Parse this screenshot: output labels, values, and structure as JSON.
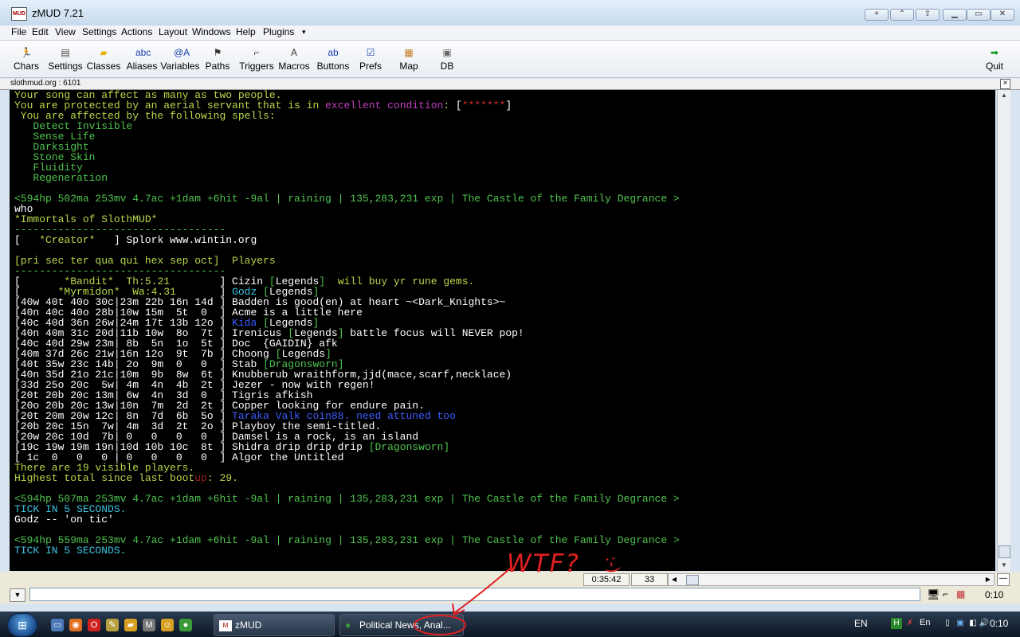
{
  "window": {
    "app_icon_text": "MUD",
    "title": "zMUD 7.21",
    "buttons": [
      "+",
      "⌃",
      "⇧",
      "▁",
      "▭",
      "✕"
    ]
  },
  "menubar": [
    "File",
    "Edit",
    "View",
    "Settings",
    "Actions",
    "Layout",
    "Windows",
    "Help",
    "Plugins",
    "▾"
  ],
  "toolbar": [
    {
      "label": "Chars",
      "icon": "running-man-icon",
      "glyph": "🏃",
      "color": "#0a9a1a"
    },
    {
      "label": "Settings",
      "icon": "settings-book-icon",
      "glyph": "▤",
      "color": "#444"
    },
    {
      "label": "Classes",
      "icon": "folder-icon",
      "glyph": "▰",
      "color": "#e8b000"
    },
    {
      "label": "Aliases",
      "icon": "abc-icon",
      "glyph": "abc",
      "color": "#1a3fb0"
    },
    {
      "label": "Variables",
      "icon": "variable-icon",
      "glyph": "@A",
      "color": "#1a3fb0"
    },
    {
      "label": "Paths",
      "icon": "walking-path-icon",
      "glyph": "⚑",
      "color": "#333"
    },
    {
      "label": "Triggers",
      "icon": "gun-trigger-icon",
      "glyph": "⌐",
      "color": "#333"
    },
    {
      "label": "Macros",
      "icon": "key-icon",
      "glyph": "A",
      "color": "#333"
    },
    {
      "label": "Buttons",
      "icon": "button-icon",
      "glyph": "ab",
      "color": "#1a3fb0"
    },
    {
      "label": "Prefs",
      "icon": "checkbox-icon",
      "glyph": "☑",
      "color": "#1a3fb0"
    },
    {
      "label": "Map",
      "icon": "map-icon",
      "glyph": "▦",
      "color": "#c07a20"
    },
    {
      "label": "DB",
      "icon": "database-icon",
      "glyph": "▣",
      "color": "#666"
    }
  ],
  "quit": {
    "label": "Quit",
    "glyph": "➡",
    "color": "#0a9a1a"
  },
  "session": {
    "title": "slothmud.org : 6101",
    "close": "×"
  },
  "palette": {
    "green": "#4fc44f",
    "ygreen": "#b8d84a",
    "bright": "#ffffff",
    "cyan": "#3fc3e0",
    "blue": "#3c5cff",
    "magenta": "#c040c0",
    "red": "#e03030",
    "gray": "#c0c0c0",
    "dred": "#a02020"
  },
  "terminal_lines": [
    [
      [
        "Your song can affect as many as two people.",
        "ygreen"
      ]
    ],
    [
      [
        "You are protected by an aerial servant that is in ",
        "ygreen"
      ],
      [
        "excellent condition",
        "magenta"
      ],
      [
        ": ",
        "ygreen"
      ],
      [
        "[",
        "bright"
      ],
      [
        "*******",
        "red"
      ],
      [
        "]",
        "bright"
      ]
    ],
    [
      [
        " You are affected by the following spells:",
        "ygreen"
      ]
    ],
    [
      [
        "   Detect Invisible",
        "green"
      ]
    ],
    [
      [
        "   Sense Life",
        "green"
      ]
    ],
    [
      [
        "   Darksight",
        "green"
      ]
    ],
    [
      [
        "   Stone Skin",
        "green"
      ]
    ],
    [
      [
        "   Fluidity",
        "green"
      ]
    ],
    [
      [
        "   Regeneration",
        "green"
      ]
    ],
    [
      [
        "",
        "gray"
      ]
    ],
    [
      [
        "<594hp 502ma 253mv 4.7ac +1dam +6hit -9al | raining | 135,283,231 exp | The Castle of the Family Degrance >",
        "green"
      ]
    ],
    [
      [
        "who",
        "bright"
      ]
    ],
    [
      [
        "*Immortals of SlothMUD*",
        "ygreen"
      ]
    ],
    [
      [
        "----------------------------------",
        "green"
      ]
    ],
    [
      [
        "[   ",
        "bright"
      ],
      [
        "*Creator*",
        "ygreen"
      ],
      [
        "   ] Splork www.wintin.org",
        "bright"
      ]
    ],
    [
      [
        "",
        "gray"
      ]
    ],
    [
      [
        "[pri sec ter qua qui hex sep oct]  Players",
        "ygreen"
      ]
    ],
    [
      [
        "----------------------------------",
        "green"
      ]
    ],
    [
      [
        "[       ",
        "bright"
      ],
      [
        "*Bandit*  Th:5.21",
        "ygreen"
      ],
      [
        "        ] Cizin ",
        "bright"
      ],
      [
        "[",
        "green"
      ],
      [
        "Legends",
        "bright"
      ],
      [
        "]",
        "green"
      ],
      [
        "  will buy yr rune gems.",
        "ygreen"
      ]
    ],
    [
      [
        "[      ",
        "bright"
      ],
      [
        "*Myrmidon*  Wa:4.31",
        "ygreen"
      ],
      [
        "       ] ",
        "bright"
      ],
      [
        "Godz ",
        "cyan"
      ],
      [
        "[",
        "green"
      ],
      [
        "Legends",
        "bright"
      ],
      [
        "]",
        "green"
      ]
    ],
    [
      [
        "[40w 40t 40o 30c|23m 22b 16n 14d ] Badden is good(en) at heart ~<Dark_Knights>~",
        "bright"
      ]
    ],
    [
      [
        "[40n 40c 40o 28b|10w 15m  5t  0  ] Acme is a little here",
        "bright"
      ]
    ],
    [
      [
        "[40c 40d 36n 26w|24m 17t 13b 12o ] ",
        "bright"
      ],
      [
        "Kida ",
        "blue"
      ],
      [
        "[",
        "green"
      ],
      [
        "Legends",
        "bright"
      ],
      [
        "]",
        "green"
      ]
    ],
    [
      [
        "[40n 40m 31c 20d|11b 10w  8o  7t ] Irenicus ",
        "bright"
      ],
      [
        "[",
        "green"
      ],
      [
        "Legends",
        "bright"
      ],
      [
        "]",
        "green"
      ],
      [
        " battle focus will NEVER pop!",
        "bright"
      ]
    ],
    [
      [
        "[40c 40d 29w 23m| 8b  5n  1o  5t ] Doc  {GAIDIN} afk",
        "bright"
      ]
    ],
    [
      [
        "[40m 37d 26c 21w|16n 12o  9t  7b ] Choong ",
        "bright"
      ],
      [
        "[",
        "green"
      ],
      [
        "Legends",
        "bright"
      ],
      [
        "]",
        "green"
      ]
    ],
    [
      [
        "[40t 35w 23c 14b| 2o  9m  0   0  ] Stab ",
        "bright"
      ],
      [
        "[",
        "green"
      ],
      [
        "Dragonsworn",
        "green"
      ],
      [
        "]",
        "green"
      ]
    ],
    [
      [
        "[40n 35d 21o 21c|10m  9b  8w  6t ] Knubberub wraithform,jjd(mace,scarf,necklace)",
        "bright"
      ]
    ],
    [
      [
        "[33d 25o 20c  5w| 4m  4n  4b  2t ] Jezer - now with regen!",
        "bright"
      ]
    ],
    [
      [
        "[20t 20b 20c 13m| 6w  4n  3d  0  ] Tigris afkish",
        "bright"
      ]
    ],
    [
      [
        "[20o 20b 20c 13w|10n  7m  2d  2t ] Copper looking for endure pain.",
        "bright"
      ]
    ],
    [
      [
        "[20t 20m 20w 12c| 8n  7d  6b  5o ] ",
        "bright"
      ],
      [
        "Taraka Valk coin88. need attuned too",
        "blue"
      ]
    ],
    [
      [
        "[20b 20c 15n  7w| 4m  3d  2t  2o ] Playboy the semi-titled.",
        "bright"
      ]
    ],
    [
      [
        "[20w 20c 10d  7b| 0   0   0   0  ] Damsel is a rock, is an island",
        "bright"
      ]
    ],
    [
      [
        "[19c 19w 19m 19n|10d 10b 10c  8t ] Shidra drip drip drip ",
        "bright"
      ],
      [
        "[",
        "green"
      ],
      [
        "Dragonsworn",
        "green"
      ],
      [
        "]",
        "green"
      ]
    ],
    [
      [
        "[ 1c  0   0   0 | 0   0   0   0  ] Algor the Untitled",
        "bright"
      ]
    ],
    [
      [
        "There are 19 visible players.",
        "ygreen"
      ]
    ],
    [
      [
        "Highest total since last boot",
        "ygreen"
      ],
      [
        "up",
        "dred"
      ],
      [
        ": 29.",
        "ygreen"
      ]
    ],
    [
      [
        "",
        "gray"
      ]
    ],
    [
      [
        "<594hp 507ma 253mv 4.7ac +1dam +6hit -9al | raining | 135,283,231 exp | The Castle of the Family Degrance >",
        "green"
      ]
    ],
    [
      [
        "TICK IN 5 SECONDS.",
        "cyan"
      ]
    ],
    [
      [
        "Godz -- 'on tic'",
        "bright"
      ]
    ],
    [
      [
        "",
        "gray"
      ]
    ],
    [
      [
        "<594hp 559ma 253mv 4.7ac +1dam +6hit -9al | raining | 135,283,231 exp | The Castle of the Family Degrance >",
        "green"
      ]
    ],
    [
      [
        "TICK IN 5 SECONDS.",
        "cyan"
      ]
    ]
  ],
  "status": {
    "time": "0:35:42",
    "lines": "33",
    "clock_right": "0:10"
  },
  "input": {
    "value": "",
    "placeholder": "",
    "dropdown": "▼"
  },
  "annotation": {
    "text": "WTF?",
    "smile": ":-)",
    "color": "#e02020"
  },
  "taskbar": {
    "start": "⊞",
    "quicklaunch": [
      {
        "name": "show-desktop-icon",
        "glyph": "▭",
        "color": "#4a78b8"
      },
      {
        "name": "firefox-icon",
        "glyph": "◉",
        "color": "#e07020"
      },
      {
        "name": "opera-icon",
        "glyph": "O",
        "color": "#d02020"
      },
      {
        "name": "pen-icon",
        "glyph": "✎",
        "color": "#b8a040"
      },
      {
        "name": "folder-icon",
        "glyph": "▰",
        "color": "#d8a020"
      },
      {
        "name": "zmud-icon",
        "glyph": "M",
        "color": "#777"
      },
      {
        "name": "messenger-icon",
        "glyph": "☺",
        "color": "#d8a020"
      },
      {
        "name": "chrome-icon",
        "glyph": "●",
        "color": "#3a9a3a"
      }
    ],
    "tasks": [
      {
        "label": "zMUD",
        "glyph": "M"
      },
      {
        "label": "Political News, Anal...",
        "glyph": "●"
      }
    ],
    "lang": "EN",
    "tray_lang": "En",
    "clock": "0:10"
  }
}
